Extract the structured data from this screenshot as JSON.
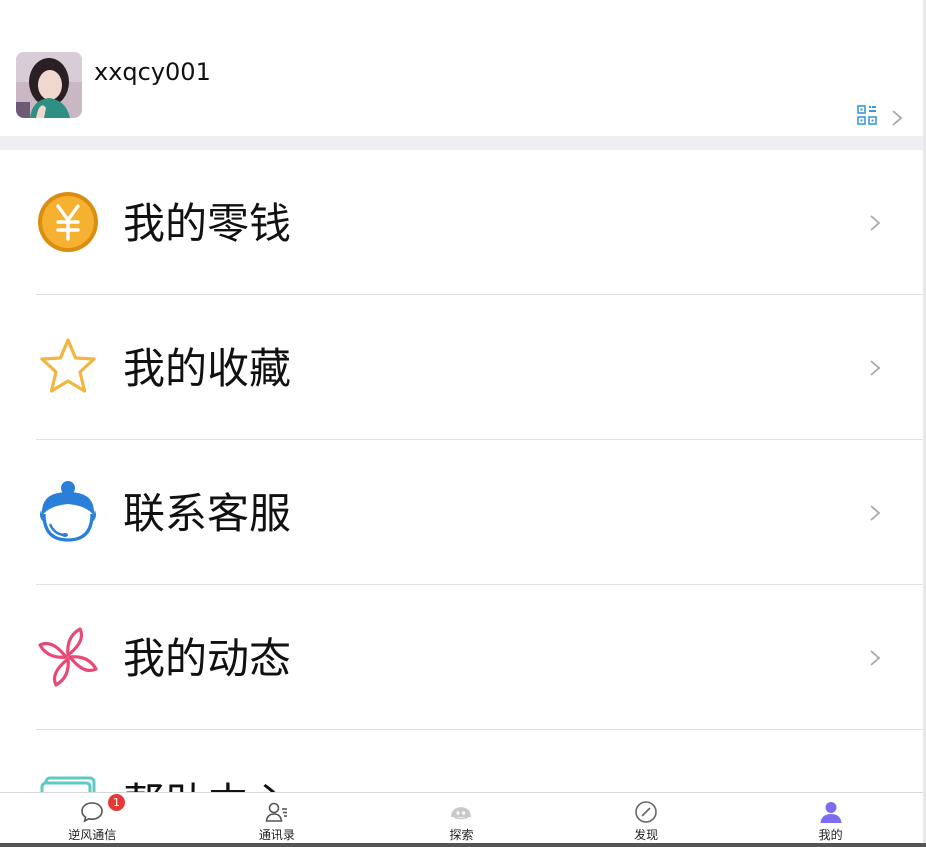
{
  "profile": {
    "username": "xxqcy001"
  },
  "menu": {
    "items": [
      {
        "label": "我的零钱"
      },
      {
        "label": "我的收藏"
      },
      {
        "label": "联系客服"
      },
      {
        "label": "我的动态"
      },
      {
        "label": "帮助中心"
      }
    ]
  },
  "tabbar": {
    "tabs": [
      {
        "label": "逆风通信",
        "badge": "1"
      },
      {
        "label": "通讯录"
      },
      {
        "label": "探索"
      },
      {
        "label": "发现"
      },
      {
        "label": "我的"
      }
    ]
  },
  "colors": {
    "accent_active": "#7b6cf0",
    "badge": "#e53935",
    "wallet": "#f5b12f",
    "favorites": "#f2b640",
    "service": "#2a7fd8",
    "moments": "#e84a76"
  }
}
